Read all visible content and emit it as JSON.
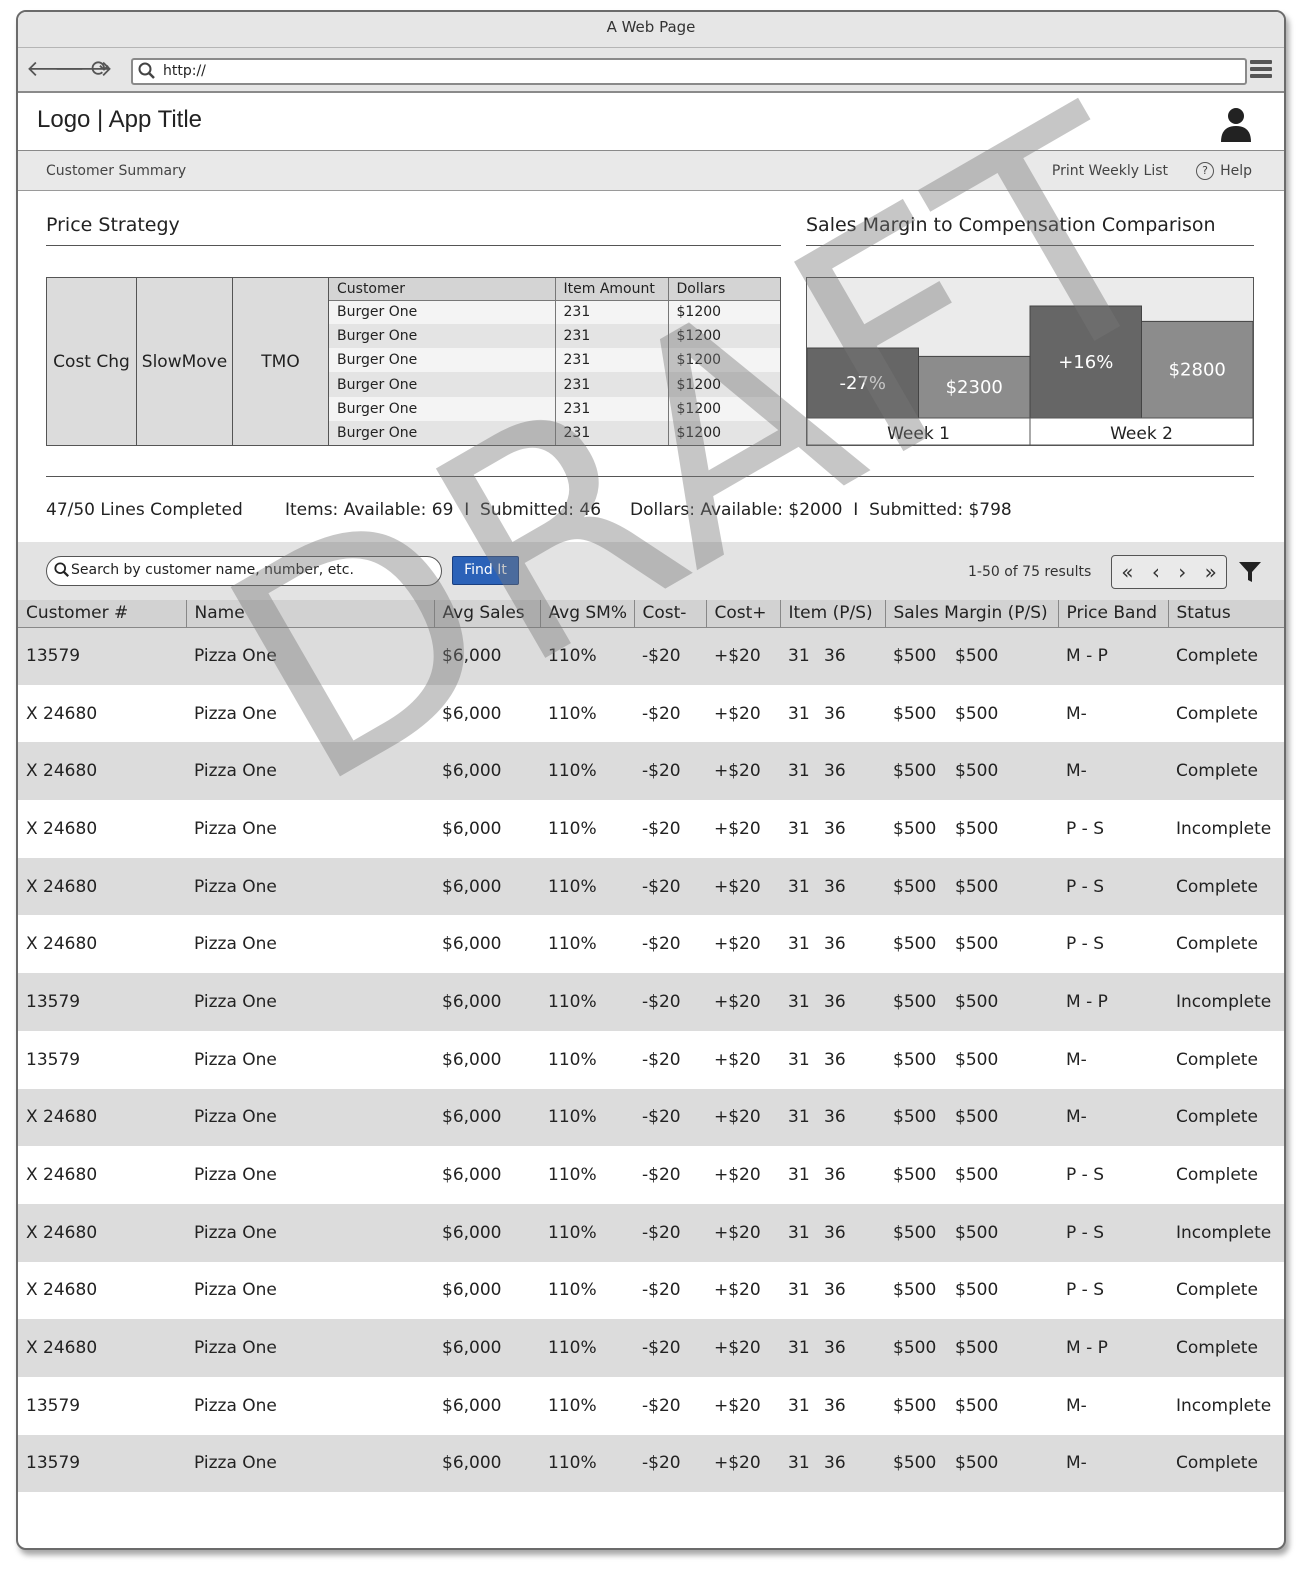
{
  "browser": {
    "window_title": "A Web Page",
    "url": "http://"
  },
  "app": {
    "title": "Logo | App Title"
  },
  "subnav": {
    "left_link": "Customer Summary",
    "print_link": "Print Weekly List",
    "help_link": "Help"
  },
  "price_strategy": {
    "title": "Price Strategy",
    "labels": [
      "Cost Chg",
      "SlowMove",
      "TMO"
    ],
    "columns": [
      "Customer",
      "Item Amount",
      "Dollars"
    ],
    "rows": [
      [
        "Burger One",
        "231",
        "$1200"
      ],
      [
        "Burger One",
        "231",
        "$1200"
      ],
      [
        "Burger One",
        "231",
        "$1200"
      ],
      [
        "Burger One",
        "231",
        "$1200"
      ],
      [
        "Burger One",
        "231",
        "$1200"
      ],
      [
        "Burger One",
        "231",
        "$1200"
      ]
    ]
  },
  "comparison": {
    "title": "Sales Margin to Compensation Comparison"
  },
  "chart_data": {
    "type": "bar",
    "categories": [
      "Week 1",
      "Week 2"
    ],
    "series": [
      {
        "labels": [
          "-27%",
          "+16%"
        ],
        "values": [
          50,
          80
        ],
        "color": "#666666"
      },
      {
        "labels": [
          "$2300",
          "$2800"
        ],
        "values": [
          44,
          69
        ],
        "color": "#8c8c8c"
      }
    ],
    "ylim": [
      0,
      100
    ],
    "title": "",
    "xlabel": "",
    "ylabel": ""
  },
  "stats": {
    "lines": "47/50 Lines Completed",
    "items": "Items: Available: 69  I  Submitted: 46",
    "dollars": "Dollars: Available: $2000  I  Submitted: $798"
  },
  "search": {
    "placeholder": "Search by customer name, number, etc.",
    "button": "Find It",
    "results": "1-50 of 75 results"
  },
  "pager": {
    "first": "«",
    "prev": "‹",
    "next": "›",
    "last": "»"
  },
  "watermark": "DRAFT",
  "grid": {
    "columns": [
      "Customer #",
      "Name",
      "Avg Sales",
      "Avg SM%",
      "Cost-",
      "Cost+",
      "Item (P/S)",
      "Sales Margin (P/S)",
      "Price Band",
      "Status"
    ],
    "rows": [
      [
        "13579",
        "Pizza One",
        "$6,000",
        "110%",
        "-$20",
        "+$20",
        "31",
        "36",
        "$500",
        "$500",
        "M - P",
        "Complete"
      ],
      [
        "X 24680",
        "Pizza One",
        "$6,000",
        "110%",
        "-$20",
        "+$20",
        "31",
        "36",
        "$500",
        "$500",
        "M-",
        "Complete"
      ],
      [
        "X 24680",
        "Pizza One",
        "$6,000",
        "110%",
        "-$20",
        "+$20",
        "31",
        "36",
        "$500",
        "$500",
        "M-",
        "Complete"
      ],
      [
        "X 24680",
        "Pizza One",
        "$6,000",
        "110%",
        "-$20",
        "+$20",
        "31",
        "36",
        "$500",
        "$500",
        "P - S",
        "Incomplete"
      ],
      [
        "X 24680",
        "Pizza One",
        "$6,000",
        "110%",
        "-$20",
        "+$20",
        "31",
        "36",
        "$500",
        "$500",
        "P - S",
        "Complete"
      ],
      [
        "X 24680",
        "Pizza One",
        "$6,000",
        "110%",
        "-$20",
        "+$20",
        "31",
        "36",
        "$500",
        "$500",
        "P - S",
        "Complete"
      ],
      [
        "13579",
        "Pizza One",
        "$6,000",
        "110%",
        "-$20",
        "+$20",
        "31",
        "36",
        "$500",
        "$500",
        "M - P",
        "Incomplete"
      ],
      [
        "13579",
        "Pizza One",
        "$6,000",
        "110%",
        "-$20",
        "+$20",
        "31",
        "36",
        "$500",
        "$500",
        "M-",
        "Complete"
      ],
      [
        "X 24680",
        "Pizza One",
        "$6,000",
        "110%",
        "-$20",
        "+$20",
        "31",
        "36",
        "$500",
        "$500",
        "M-",
        "Complete"
      ],
      [
        "X 24680",
        "Pizza One",
        "$6,000",
        "110%",
        "-$20",
        "+$20",
        "31",
        "36",
        "$500",
        "$500",
        "P - S",
        "Complete"
      ],
      [
        "X 24680",
        "Pizza One",
        "$6,000",
        "110%",
        "-$20",
        "+$20",
        "31",
        "36",
        "$500",
        "$500",
        "P - S",
        "Incomplete"
      ],
      [
        "X 24680",
        "Pizza One",
        "$6,000",
        "110%",
        "-$20",
        "+$20",
        "31",
        "36",
        "$500",
        "$500",
        "P - S",
        "Complete"
      ],
      [
        "X 24680",
        "Pizza One",
        "$6,000",
        "110%",
        "-$20",
        "+$20",
        "31",
        "36",
        "$500",
        "$500",
        "M - P",
        "Complete"
      ],
      [
        "13579",
        "Pizza One",
        "$6,000",
        "110%",
        "-$20",
        "+$20",
        "31",
        "36",
        "$500",
        "$500",
        "M-",
        "Incomplete"
      ],
      [
        "13579",
        "Pizza One",
        "$6,000",
        "110%",
        "-$20",
        "+$20",
        "31",
        "36",
        "$500",
        "$500",
        "M-",
        "Complete"
      ]
    ]
  }
}
